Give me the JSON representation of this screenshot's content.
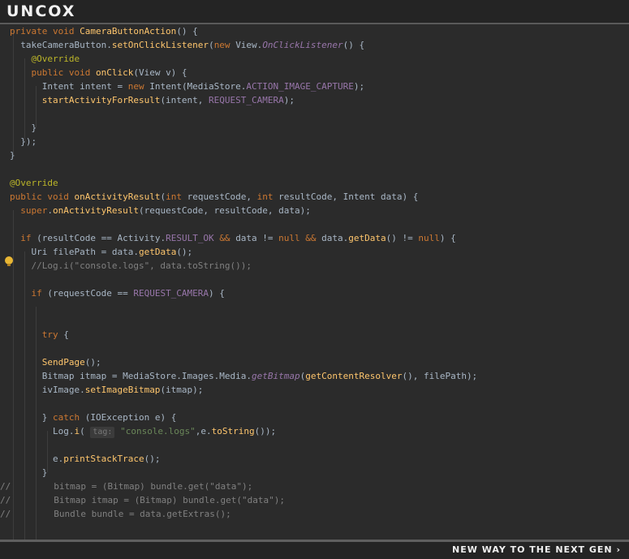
{
  "header": {
    "logo": "UNCOX"
  },
  "footer": {
    "tagline": "NEW WAY TO THE NEXT GEN ›"
  },
  "colors": {
    "background": "#2b2b2b",
    "keyword": "#cc7832",
    "method": "#ffc66d",
    "annotation": "#bbb529",
    "field": "#9876aa",
    "string": "#6a8759",
    "comment": "#808080",
    "lightbulb": "#e8b634"
  },
  "icons": {
    "gutter_hint": "lightbulb-icon"
  },
  "code": {
    "lines": [
      [
        [
          "k",
          "private void "
        ],
        [
          "f",
          "CameraButtonAction"
        ],
        [
          "t",
          "() {"
        ]
      ],
      [
        [
          "t",
          "  takeCameraButton."
        ],
        [
          "f",
          "setOnClickListener"
        ],
        [
          "t",
          "("
        ],
        [
          "k",
          "new "
        ],
        [
          "t",
          "View."
        ],
        [
          "i",
          "OnClickListener"
        ],
        [
          "t",
          "() {"
        ]
      ],
      [
        [
          "a",
          "    @Override"
        ]
      ],
      [
        [
          "k",
          "    public void "
        ],
        [
          "f",
          "onClick"
        ],
        [
          "t",
          "(View v) {"
        ]
      ],
      [
        [
          "t",
          "      Intent intent = "
        ],
        [
          "k",
          "new "
        ],
        [
          "t",
          "Intent(MediaStore."
        ],
        [
          "v",
          "ACTION_IMAGE_CAPTURE"
        ],
        [
          "t",
          ");"
        ]
      ],
      [
        [
          "f",
          "      startActivityForResult"
        ],
        [
          "t",
          "(intent, "
        ],
        [
          "v",
          "REQUEST_CAMERA"
        ],
        [
          "t",
          ");"
        ]
      ],
      [],
      [
        [
          "t",
          "    }"
        ]
      ],
      [
        [
          "t",
          "  });"
        ]
      ],
      [
        [
          "t",
          "}"
        ]
      ],
      [],
      [
        [
          "a",
          "@Override"
        ]
      ],
      [
        [
          "k",
          "public void "
        ],
        [
          "f",
          "onActivityResult"
        ],
        [
          "t",
          "("
        ],
        [
          "k",
          "int "
        ],
        [
          "t",
          "requestCode, "
        ],
        [
          "k",
          "int "
        ],
        [
          "t",
          "resultCode, Intent data) {"
        ]
      ],
      [
        [
          "k",
          "  super"
        ],
        [
          "t",
          "."
        ],
        [
          "f",
          "onActivityResult"
        ],
        [
          "t",
          "(requestCode, resultCode, data);"
        ]
      ],
      [],
      [
        [
          "k",
          "  if "
        ],
        [
          "t",
          "(resultCode == Activity."
        ],
        [
          "v",
          "RESULT_OK "
        ],
        [
          "k",
          "&& "
        ],
        [
          "t",
          "data != "
        ],
        [
          "k",
          "null "
        ],
        [
          "k",
          "&& "
        ],
        [
          "t",
          "data."
        ],
        [
          "f",
          "getData"
        ],
        [
          "t",
          "() != "
        ],
        [
          "k",
          "null"
        ],
        [
          "t",
          ") {"
        ]
      ],
      [
        [
          "t",
          "    Uri filePath = data."
        ],
        [
          "f",
          "getData"
        ],
        [
          "t",
          "();"
        ]
      ],
      [
        [
          "c",
          "    //Log.i(\"console.logs\", data.toString());"
        ]
      ],
      [],
      [
        [
          "k",
          "    if "
        ],
        [
          "t",
          "(requestCode == "
        ],
        [
          "v",
          "REQUEST_CAMERA"
        ],
        [
          "t",
          ") {"
        ]
      ],
      [],
      [],
      [
        [
          "k",
          "      try "
        ],
        [
          "t",
          "{"
        ]
      ],
      [],
      [
        [
          "f",
          "      SendPage"
        ],
        [
          "t",
          "();"
        ]
      ],
      [
        [
          "t",
          "      Bitmap itmap = MediaStore.Images.Media."
        ],
        [
          "i",
          "getBitmap"
        ],
        [
          "t",
          "("
        ],
        [
          "f",
          "getContentResolver"
        ],
        [
          "t",
          "(), filePath);"
        ]
      ],
      [
        [
          "t",
          "      ivImage."
        ],
        [
          "f",
          "setImageBitmap"
        ],
        [
          "t",
          "(itmap);"
        ]
      ],
      [],
      [
        [
          "t",
          "      } "
        ],
        [
          "k",
          "catch "
        ],
        [
          "t",
          "(IOException e) {"
        ]
      ],
      [
        [
          "t",
          "        Log."
        ],
        [
          "f",
          "i"
        ],
        [
          "t",
          "( "
        ],
        [
          "h",
          "tag:"
        ],
        [
          "s",
          " \"console.logs\""
        ],
        [
          "t",
          ",e."
        ],
        [
          "f",
          "toString"
        ],
        [
          "t",
          "());"
        ]
      ],
      [],
      [
        [
          "t",
          "        e."
        ],
        [
          "f",
          "printStackTrace"
        ],
        [
          "t",
          "();"
        ]
      ],
      [
        [
          "t",
          "      }"
        ]
      ],
      [
        [
          "c",
          "//        bitmap = (Bitmap) bundle.get(\"data\");"
        ]
      ],
      [
        [
          "c",
          "//        Bitmap itmap = (Bitmap) bundle.get(\"data\");"
        ]
      ],
      [
        [
          "c",
          "//        Bundle bundle = data.getExtras();"
        ]
      ],
      [],
      []
    ]
  }
}
